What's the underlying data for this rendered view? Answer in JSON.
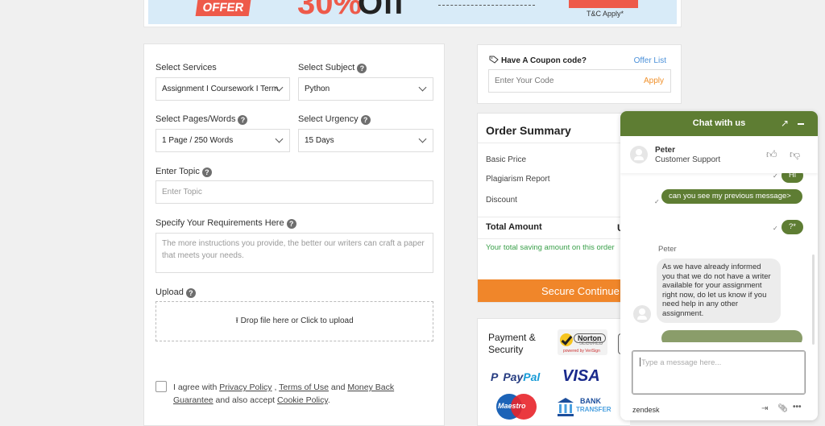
{
  "banner": {
    "offer_label": "OFFER",
    "discount_pct": "30%",
    "discount_word": "Off",
    "terms": "T&C Apply*"
  },
  "form": {
    "services": {
      "label": "Select Services",
      "value": "Assignment I Coursework I Term"
    },
    "subject": {
      "label": "Select Subject",
      "value": "Python"
    },
    "pages": {
      "label": "Select Pages/Words",
      "value": "1 Page / 250 Words"
    },
    "urgency": {
      "label": "Select Urgency",
      "value": "15 Days"
    },
    "topic": {
      "label": "Enter Topic",
      "placeholder": "Enter Topic"
    },
    "requirements": {
      "label": "Specify Your Requirements Here",
      "placeholder": "The more instructions you provide, the better our writers can craft a paper that meets your needs."
    },
    "upload": {
      "label": "Upload",
      "drop_text": "Drop file here or Click to upload"
    },
    "help_glyph": "?",
    "agree": {
      "prefix": "I agree with ",
      "privacy": "Privacy Policy",
      "sep": " , ",
      "terms": "Terms of Use",
      "and": " and ",
      "money_back": "Money Back Guarantee",
      "also": " and also accept ",
      "cookie": "Cookie Policy",
      "end": "."
    }
  },
  "coupon": {
    "title": "Have A Coupon code?",
    "offer_list": "Offer List",
    "placeholder": "Enter Your Code",
    "apply": "Apply"
  },
  "summary": {
    "title": "Order Summary",
    "rows": [
      "Basic Price",
      "Plagiarism Report",
      "Discount"
    ],
    "total_label": "Total Amount",
    "total_value_partial": "U",
    "saving_text": "Your total saving amount on this order",
    "secure_button": "Secure Continue"
  },
  "payment": {
    "title_line1": "Payment &",
    "title_line2": "Security",
    "norton": {
      "name": "Norton",
      "secured": "SECURED",
      "powered": "powered by VeriSign"
    },
    "paypal": {
      "pay": "Pay",
      "pal": "Pal",
      "p": "P"
    },
    "visa": "VISA",
    "maestro": "Maestro",
    "bank": {
      "line1": "BANK",
      "line2": "TRANSFER"
    }
  },
  "chat": {
    "header_title": "Chat with us",
    "agent_name": "Peter",
    "agent_role": "Customer Support",
    "messages": [
      {
        "from": "user",
        "text": "Hi"
      },
      {
        "from": "user",
        "text": "can you see my previous message>"
      },
      {
        "from": "user",
        "text": "?*"
      },
      {
        "from": "agent",
        "sender": "Peter",
        "text": "As we have already informed you that we do not have a writer available for your assignment right now,  do let us know if you need help in any other assignment."
      }
    ],
    "input_placeholder": "Type a message here...",
    "brand": "zendesk",
    "accent_color": "#5e7d33"
  }
}
